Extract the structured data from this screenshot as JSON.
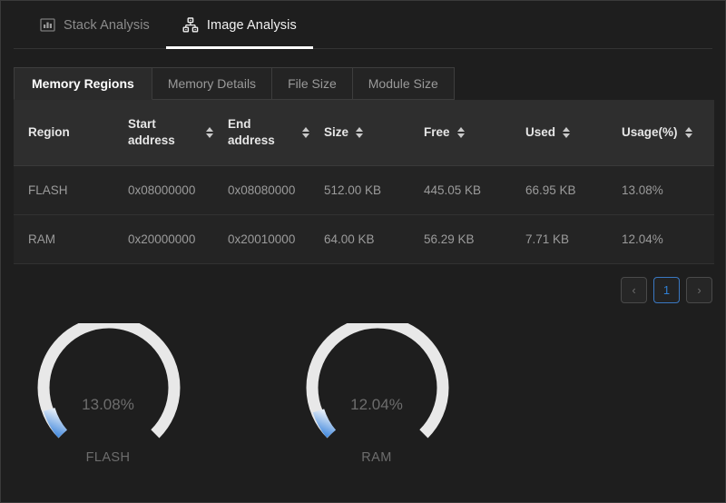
{
  "theme": {
    "page_bg": "#1e1e1e",
    "panel_bg": "#242424",
    "header_bg": "#2e2e2e",
    "accent_blue": "#2f7fd4",
    "gauge_track": "#e8e8e8",
    "gauge_fill_start": "#dbe7f5",
    "gauge_fill_end": "#3f87dd"
  },
  "top_tabs": [
    {
      "label": "Stack Analysis",
      "icon": "bar-chart-icon",
      "active": false
    },
    {
      "label": "Image Analysis",
      "icon": "sitemap-icon",
      "active": true
    }
  ],
  "sub_tabs": [
    {
      "label": "Memory Regions",
      "active": true
    },
    {
      "label": "Memory Details",
      "active": false
    },
    {
      "label": "File Size",
      "active": false
    },
    {
      "label": "Module Size",
      "active": false
    }
  ],
  "table": {
    "columns": [
      {
        "label": "Region",
        "sortable": false
      },
      {
        "label": "Start address",
        "sortable": true
      },
      {
        "label": "End address",
        "sortable": true
      },
      {
        "label": "Size",
        "sortable": true
      },
      {
        "label": "Free",
        "sortable": true
      },
      {
        "label": "Used",
        "sortable": true
      },
      {
        "label": "Usage(%)",
        "sortable": true
      }
    ],
    "rows": [
      {
        "region": "FLASH",
        "start_address": "0x08000000",
        "end_address": "0x08080000",
        "size": "512.00 KB",
        "free": "445.05 KB",
        "used": "66.95 KB",
        "usage": "13.08%"
      },
      {
        "region": "RAM",
        "start_address": "0x20000000",
        "end_address": "0x20010000",
        "size": "64.00 KB",
        "free": "56.29 KB",
        "used": "7.71 KB",
        "usage": "12.04%"
      }
    ]
  },
  "pagination": {
    "prev_label": "‹",
    "next_label": "›",
    "current_page": "1"
  },
  "chart_data": [
    {
      "type": "gauge",
      "title": "FLASH",
      "value": 13.08,
      "value_label": "13.08%",
      "min": 0,
      "max": 100,
      "unit": "%",
      "arc_span_degrees": 270,
      "track_color": "#e8e8e8",
      "fill_color": "#3f87dd"
    },
    {
      "type": "gauge",
      "title": "RAM",
      "value": 12.04,
      "value_label": "12.04%",
      "min": 0,
      "max": 100,
      "unit": "%",
      "arc_span_degrees": 270,
      "track_color": "#e8e8e8",
      "fill_color": "#3f87dd"
    }
  ]
}
